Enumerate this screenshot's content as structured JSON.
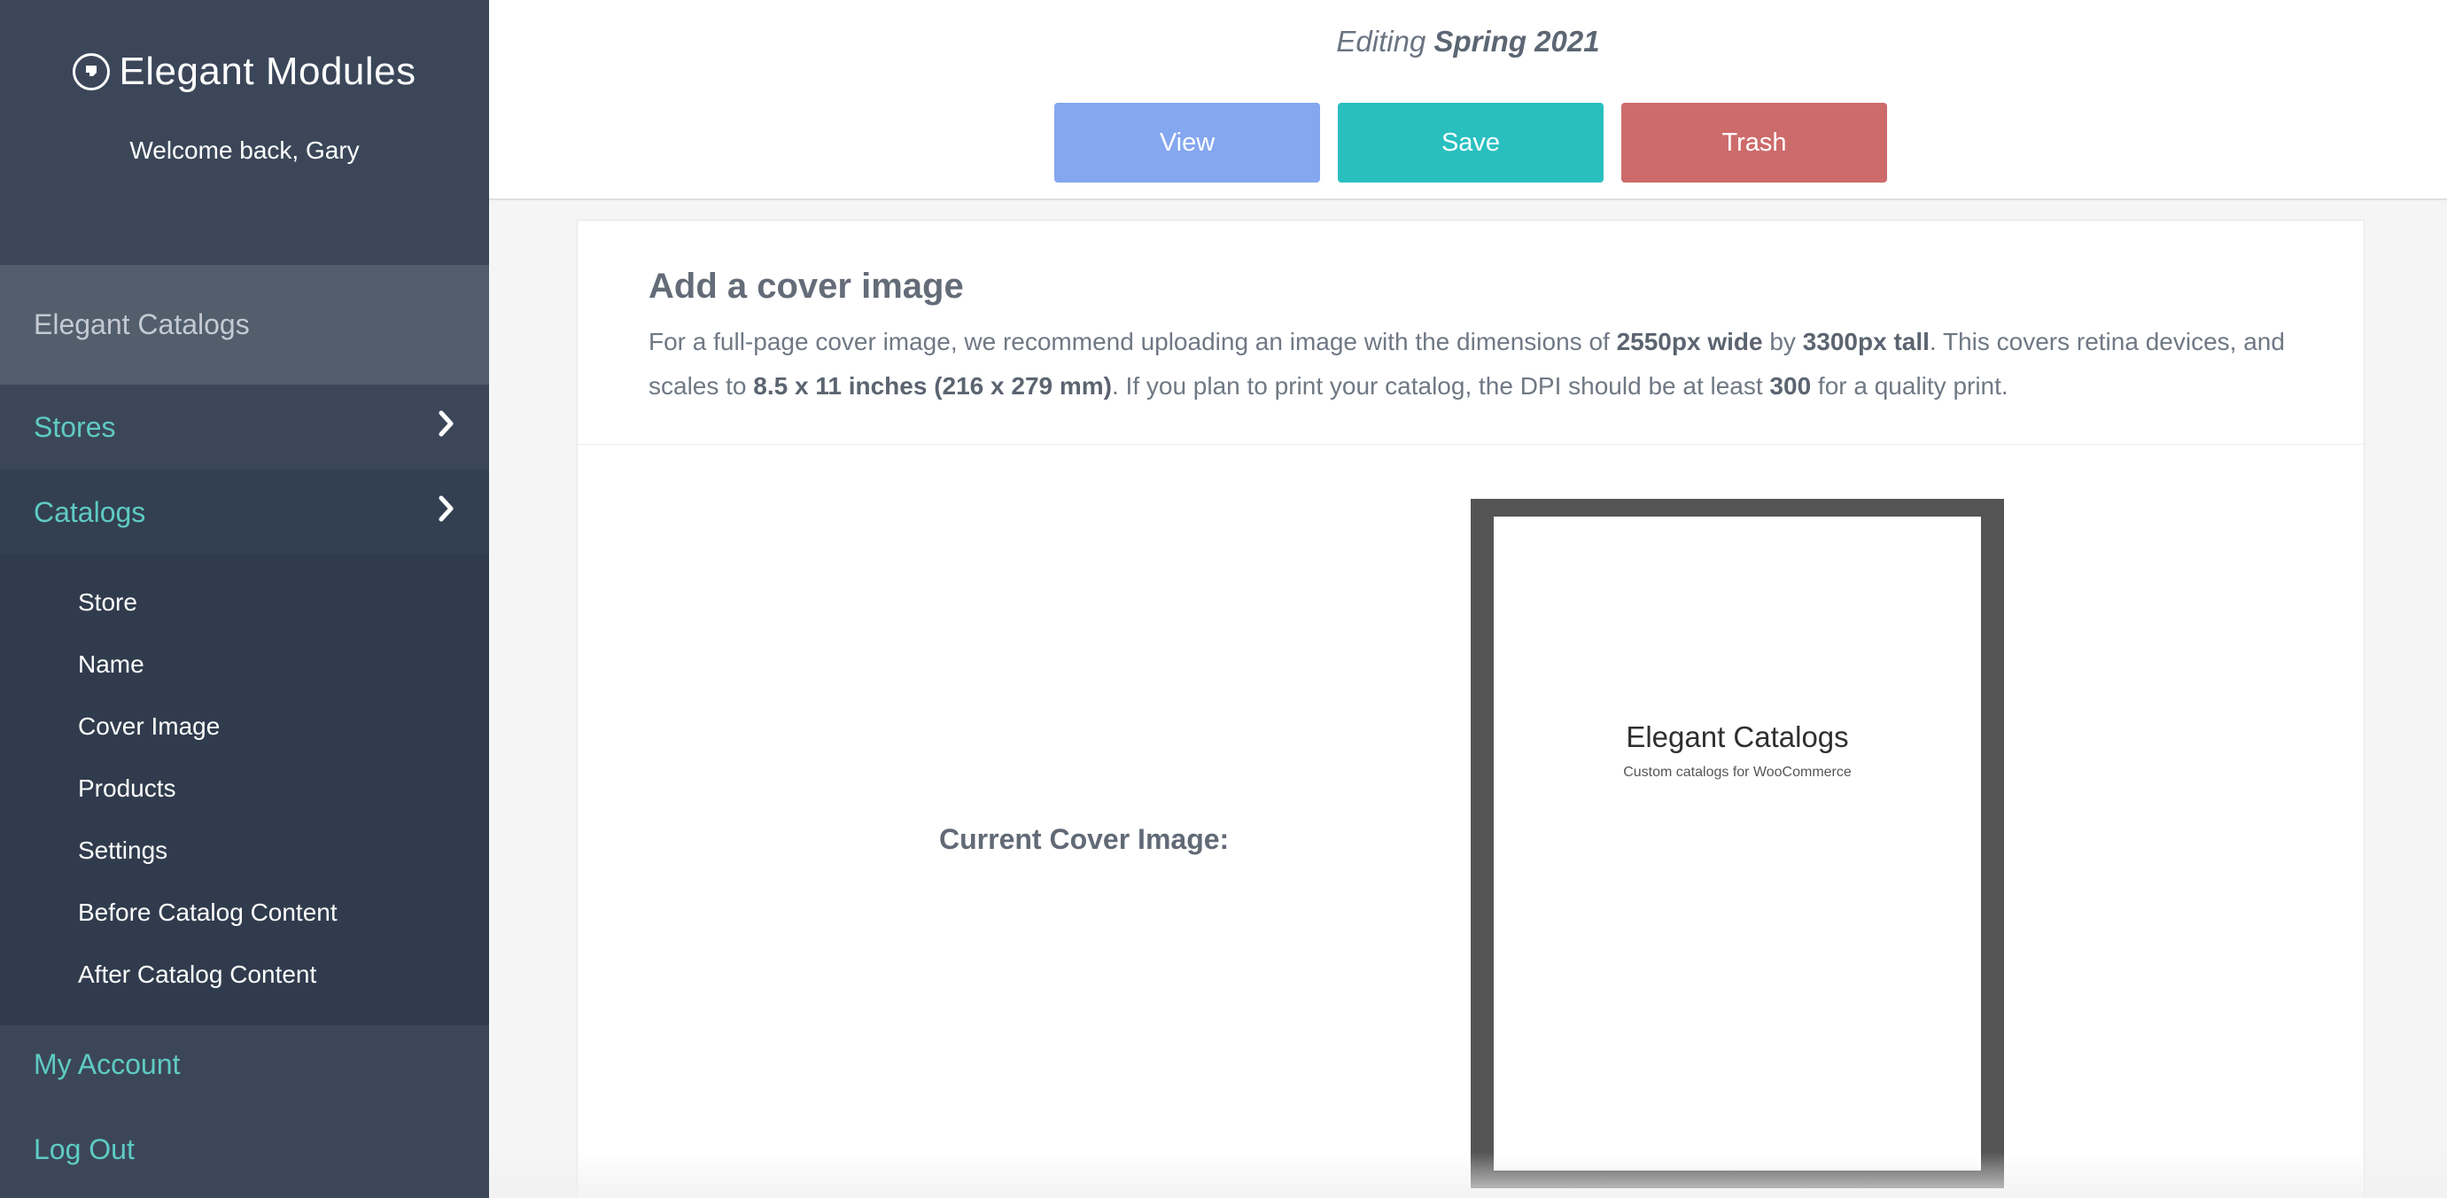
{
  "sidebar": {
    "brand": "Elegant Modules",
    "welcome": "Welcome back, Gary",
    "active_section": "Elegant Catalogs",
    "stores_label": "Stores",
    "catalogs_label": "Catalogs",
    "submenu": [
      "Store",
      "Name",
      "Cover Image",
      "Products",
      "Settings",
      "Before Catalog Content",
      "After Catalog Content"
    ],
    "my_account": "My Account",
    "log_out": "Log Out"
  },
  "header": {
    "editing_prefix": "Editing",
    "catalog_name": "Spring 2021",
    "view_label": "View",
    "save_label": "Save",
    "trash_label": "Trash"
  },
  "card": {
    "title": "Add a cover image",
    "desc": {
      "t1": "For a full-page cover image, we recommend uploading an image with the dimensions of ",
      "width": "2550px wide",
      "t2": " by ",
      "height": "3300px tall",
      "t3": ". This covers retina devices, and scales to ",
      "size": "8.5 x 11 inches (216 x 279 mm)",
      "t4": ". If you plan to print your catalog, the DPI should be at least ",
      "dpi": "300",
      "t5": " for a quality print."
    },
    "current_label": "Current Cover Image:",
    "preview_title": "Elegant Catalogs",
    "preview_subtitle": "Custom catalogs for WooCommerce"
  },
  "colors": {
    "sidebar_bg": "#3b4759",
    "accent_teal": "#5fcbc4",
    "view_btn": "#84a7ef",
    "save_btn": "#2abfbf",
    "trash_btn": "#cd6b6b"
  }
}
